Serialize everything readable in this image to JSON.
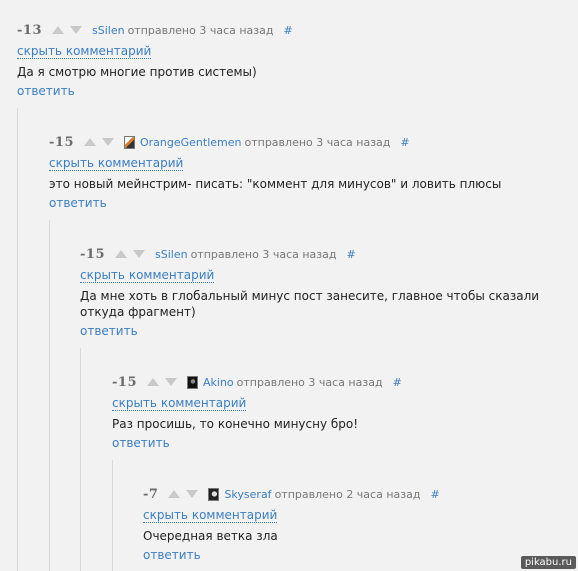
{
  "comments": [
    {
      "rating": "-13",
      "username": "sSilen",
      "posted": "отправлено 3 часа назад",
      "hash": "#",
      "hide": "скрыть комментарий",
      "text": "Да я смотрю многие против системы)",
      "reply": "ответить",
      "avatar": "none"
    },
    {
      "rating": "-15",
      "username": "OrangeGentlemen",
      "posted": "отправлено 3 часа назад",
      "hash": "#",
      "hide": "скрыть комментарий",
      "text": "это новый мейнстрим- писать: \"коммент для минусов\" и ловить плюсы",
      "reply": "ответить",
      "avatar": "orange-avatar"
    },
    {
      "rating": "-15",
      "username": "sSilen",
      "posted": "отправлено 3 часа назад",
      "hash": "#",
      "hide": "скрыть комментарий",
      "text": "Да мне хоть в глобальный минус пост занесите, главное чтобы сказали откуда фрагмент)",
      "reply": "ответить",
      "avatar": "none"
    },
    {
      "rating": "-15",
      "username": "Akino",
      "posted": "отправлено 3 часа назад",
      "hash": "#",
      "hide": "скрыть комментарий",
      "text": "Раз просишь, то конечно минусну бро!",
      "reply": "ответить",
      "avatar": "dark-avatar"
    },
    {
      "rating": "-7",
      "username": "Skyseraf",
      "posted": "отправлено 2 часа назад",
      "hash": "#",
      "hide": "скрыть комментарий",
      "text": "Очередная ветка зла",
      "reply": "ответить",
      "avatar": "face-avatar"
    }
  ],
  "watermark": "pikabu.ru"
}
